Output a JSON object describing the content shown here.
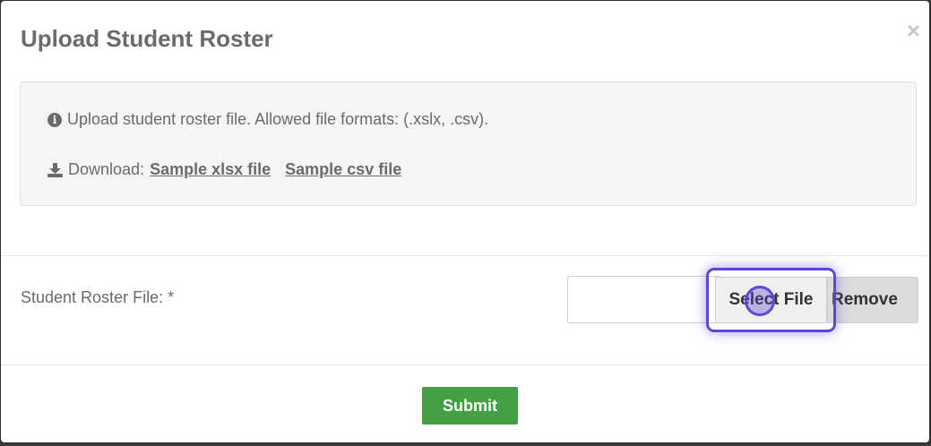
{
  "modal": {
    "title": "Upload Student Roster",
    "close_label": "×"
  },
  "info": {
    "icon": "info-circle-icon",
    "text": "Upload student roster file. Allowed file formats: (.xslx, .csv)."
  },
  "download": {
    "icon": "download-icon",
    "label": "Download:",
    "links": [
      "Sample xlsx file",
      "Sample csv file"
    ]
  },
  "form": {
    "field_label": "Student Roster File: *",
    "file_value": "",
    "select_label": "Select File",
    "remove_label": "Remove"
  },
  "footer": {
    "submit_label": "Submit"
  },
  "colors": {
    "submit": "#43a047",
    "highlight": "#5a48d6",
    "text": "#6b6b6b"
  }
}
